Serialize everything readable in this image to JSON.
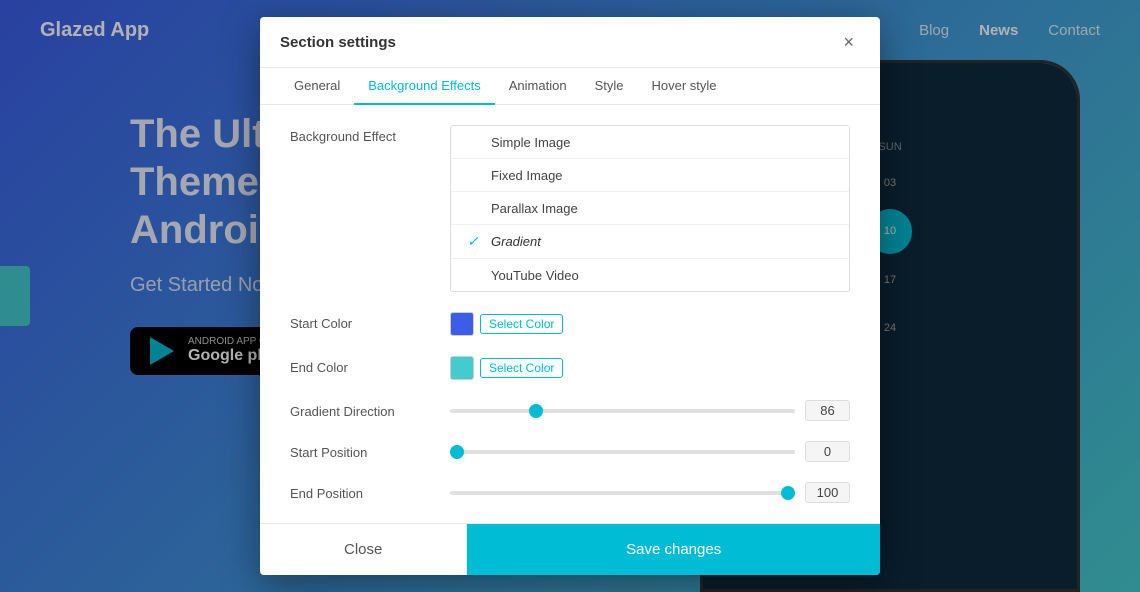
{
  "app": {
    "brand": "Glazed App"
  },
  "navbar": {
    "links": [
      "Blog",
      "News",
      "Contact"
    ],
    "active": "News"
  },
  "hero": {
    "title_line1": "The Ultim",
    "title_line2": "Theme F",
    "title_line3": "Android",
    "cta": "Get Started No",
    "play_badge_top": "ANDROID APP ON",
    "play_badge_bottom": "Google play"
  },
  "modal": {
    "title": "Section settings",
    "close_label": "×",
    "tabs": [
      "General",
      "Background Effects",
      "Animation",
      "Style",
      "Hover style"
    ],
    "active_tab": "Background Effects",
    "body": {
      "background_effect": {
        "label": "Background Effect",
        "options": [
          {
            "value": "simple_image",
            "label": "Simple Image",
            "selected": false
          },
          {
            "value": "fixed_image",
            "label": "Fixed Image",
            "selected": false
          },
          {
            "value": "parallax_image",
            "label": "Parallax Image",
            "selected": false
          },
          {
            "value": "gradient",
            "label": "Gradient",
            "selected": true
          },
          {
            "value": "youtube_video",
            "label": "YouTube Video",
            "selected": false
          }
        ]
      },
      "start_color": {
        "label": "Start Color",
        "color": "#3b5de7",
        "button_label": "Select Color"
      },
      "end_color": {
        "label": "End Color",
        "color": "#45cacd",
        "button_label": "Select Color"
      },
      "gradient_direction": {
        "label": "Gradient Direction",
        "value": 86,
        "min": 0,
        "max": 360
      },
      "start_position": {
        "label": "Start Position",
        "value": 0,
        "min": 0,
        "max": 100
      },
      "end_position": {
        "label": "End Position",
        "value": 100,
        "min": 0,
        "max": 100
      }
    },
    "footer": {
      "close_label": "Close",
      "save_label": "Save changes"
    }
  }
}
